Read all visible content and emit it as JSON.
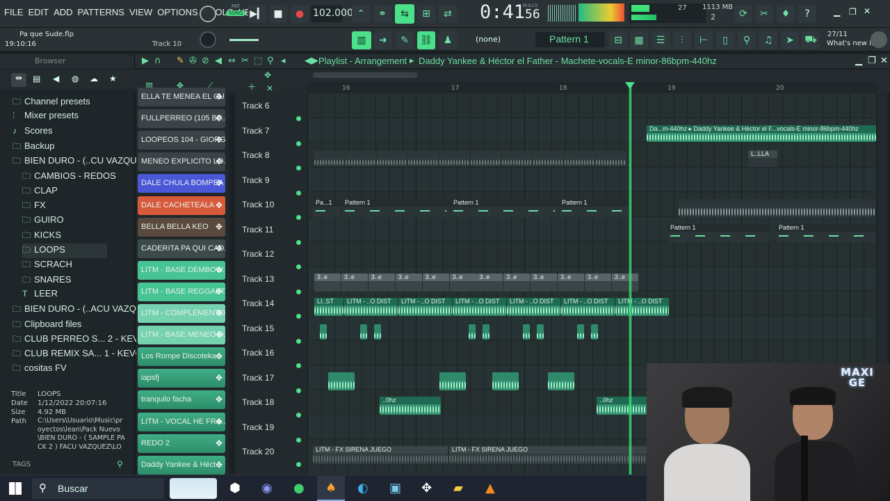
{
  "menu": [
    "FILE",
    "EDIT",
    "ADD",
    "PATTERNS",
    "VIEW",
    "OPTIONS",
    "TOOLS",
    "HELP"
  ],
  "transport": {
    "pat_label": "PAT",
    "song_label": "SONG",
    "tempo": "102.000",
    "time": "0:41",
    "time_small": "56",
    "time_unit": "M:S:CS"
  },
  "meters": {
    "cpu": "27",
    "mem": "1113 MB",
    "voices": "2"
  },
  "project": {
    "file": "Pa que Sude.flp",
    "time": "19:10:16",
    "track_hint": "Track 10"
  },
  "toolbar": {
    "pattern_selector": "Pattern 1",
    "snap": "(none)",
    "news_date": "27/11",
    "news_label": "What's new i..."
  },
  "browser": {
    "title": "Browser",
    "items": [
      {
        "label": "Channel presets",
        "icon": "folder-icon",
        "indent": 0
      },
      {
        "label": "Mixer presets",
        "icon": "mixer-icon",
        "indent": 0
      },
      {
        "label": "Scores",
        "icon": "score-icon",
        "indent": 0
      },
      {
        "label": "Backup",
        "icon": "folder-icon",
        "indent": 0
      },
      {
        "label": "BIEN DURO - (..CU VAZQUEZ",
        "icon": "folder-icon",
        "indent": 0
      },
      {
        "label": "CAMBIOS - REDOS",
        "icon": "folder-icon",
        "indent": 1
      },
      {
        "label": "CLAP",
        "icon": "folder-icon",
        "indent": 1
      },
      {
        "label": "FX",
        "icon": "folder-icon",
        "indent": 1
      },
      {
        "label": "GUIRO",
        "icon": "folder-icon",
        "indent": 1
      },
      {
        "label": "KICKS",
        "icon": "folder-icon",
        "indent": 1
      },
      {
        "label": "LOOPS",
        "icon": "folder-icon",
        "indent": 1
      },
      {
        "label": "SCRACH",
        "icon": "folder-icon",
        "indent": 1
      },
      {
        "label": "SNARES",
        "icon": "folder-icon",
        "indent": 1
      },
      {
        "label": "LEER",
        "icon": "text-icon",
        "indent": 1
      },
      {
        "label": "BIEN DURO - (..ACU VAZQUEZ",
        "icon": "folder-icon",
        "indent": 0
      },
      {
        "label": "Clipboard files",
        "icon": "folder-icon",
        "indent": 0
      },
      {
        "label": "CLUB PERREO S... 2 - KEVO DJ",
        "icon": "folder-icon",
        "indent": 0
      },
      {
        "label": "CLUB REMIX SA... 1 - KEVO DJ",
        "icon": "folder-icon",
        "indent": 0
      },
      {
        "label": "cositas FV",
        "icon": "folder-icon",
        "indent": 0
      }
    ],
    "info": {
      "title_label": "Title",
      "title": "LOOPS",
      "date_label": "Date",
      "date": "1/12/2022 20:07:16",
      "size_label": "Size",
      "size": "4.92 MB",
      "path_label": "Path",
      "path": "C:\\Users\\Usuario\\Music\\proyectos\\lean\\Pack Nuevo\\BIEN DURO - ( SAMPLE PACK 2 ) FACU VAZQUEZ\\LOO..."
    },
    "tags_label": "TAGS"
  },
  "picker": [
    {
      "label": "ELLA TE MENEA EL CU...",
      "color": "#3a4347"
    },
    {
      "label": "FULLPERREO (105 BP...",
      "color": "#3a4347"
    },
    {
      "label": "LOOPEOS 104 - GIORGI",
      "color": "#3a4347"
    },
    {
      "label": "MENEO EXPLICITO LO...",
      "color": "#3a4347"
    },
    {
      "label": "DALE CHULA BOMPEA",
      "color": "#4a58d8"
    },
    {
      "label": "DALE CACHETEALA",
      "color": "#d85a3c"
    },
    {
      "label": "BELLA BELLA KEO",
      "color": "#5a4a3e"
    },
    {
      "label": "CADERITA PA QUI CAD...",
      "color": "#3c4a4c"
    },
    {
      "label": "LITM - BASE DEMBOW...",
      "color": "#46c494"
    },
    {
      "label": "LITM - BASE REGGAET...",
      "color": "#46c494"
    },
    {
      "label": "LITM - COMPLEMENTO...",
      "color": "#74d2b0"
    },
    {
      "label": "LITM - BASE MENEO D...",
      "color": "#74d2b0"
    },
    {
      "label": "Los Rompe Discoteka...",
      "color": "#3fae86"
    },
    {
      "label": "iapsfj",
      "color": "#3fae86"
    },
    {
      "label": "tranquilo facha",
      "color": "#3fae86"
    },
    {
      "label": "LITM - VOCAL HE FRA...",
      "color": "#3fae86"
    },
    {
      "label": "REDO 2",
      "color": "#3fae86"
    },
    {
      "label": "Daddy Yankee & Héct...",
      "color": "#3fae86"
    }
  ],
  "playlist": {
    "title": "Playlist - Arrangement",
    "clip_title": "Daddy Yankee & Héctor el Father - Machete-vocals-E minor-86bpm-440hz",
    "bars": [
      "16",
      "17",
      "18",
      "19",
      "20"
    ],
    "tracks": [
      "Track 6",
      "Track 7",
      "Track 8",
      "Track 9",
      "Track 10",
      "Track 11",
      "Track 12",
      "Track 13",
      "Track 14",
      "Track 15",
      "Track 16",
      "Track 17",
      "Track 18",
      "Track 19",
      "Track 20"
    ],
    "clips": {
      "t7": "Da...m-440hz ▸ Daddy Yankee & Héctor el F...vocals-E minor-86bpm-440hz",
      "t8b": "L..LLA",
      "t10a": "Pa...1",
      "t10b": "Pattern 1",
      "t10c": "Pattern 1",
      "t10d": "Pattern 1",
      "t11a": "Pattern 1",
      "t11b": "Pattern 1",
      "t13": "3..e",
      "t14a": "LI..ST",
      "t14b": "LITM - ..O DIST",
      "t18": "..0hz",
      "t20": "LITM - FX SIRENA JUEGO"
    }
  },
  "taskbar": {
    "search": "Buscar"
  },
  "webcam": {
    "logo": "MAXI GE"
  },
  "colors": {
    "accent": "#4be08a",
    "waveform": "#7be0b0",
    "bg": "#263033"
  }
}
